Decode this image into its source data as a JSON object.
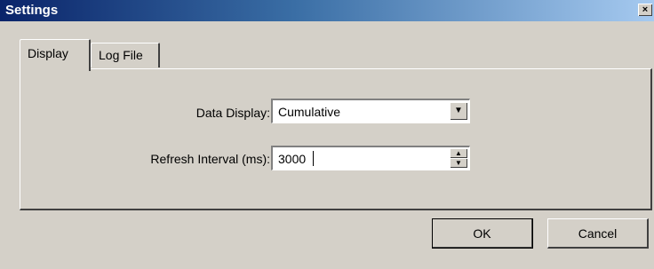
{
  "window": {
    "title": "Settings",
    "close_glyph": "×"
  },
  "tabs": [
    {
      "label": "Display",
      "active": true
    },
    {
      "label": "Log File",
      "active": false
    }
  ],
  "form": {
    "data_display": {
      "label": "Data Display:",
      "value": "Cumulative",
      "icon": "dropdown-arrow-icon"
    },
    "refresh_interval": {
      "label": "Refresh Interval (ms):",
      "value": "3000"
    }
  },
  "buttons": {
    "ok": "OK",
    "cancel": "Cancel"
  }
}
